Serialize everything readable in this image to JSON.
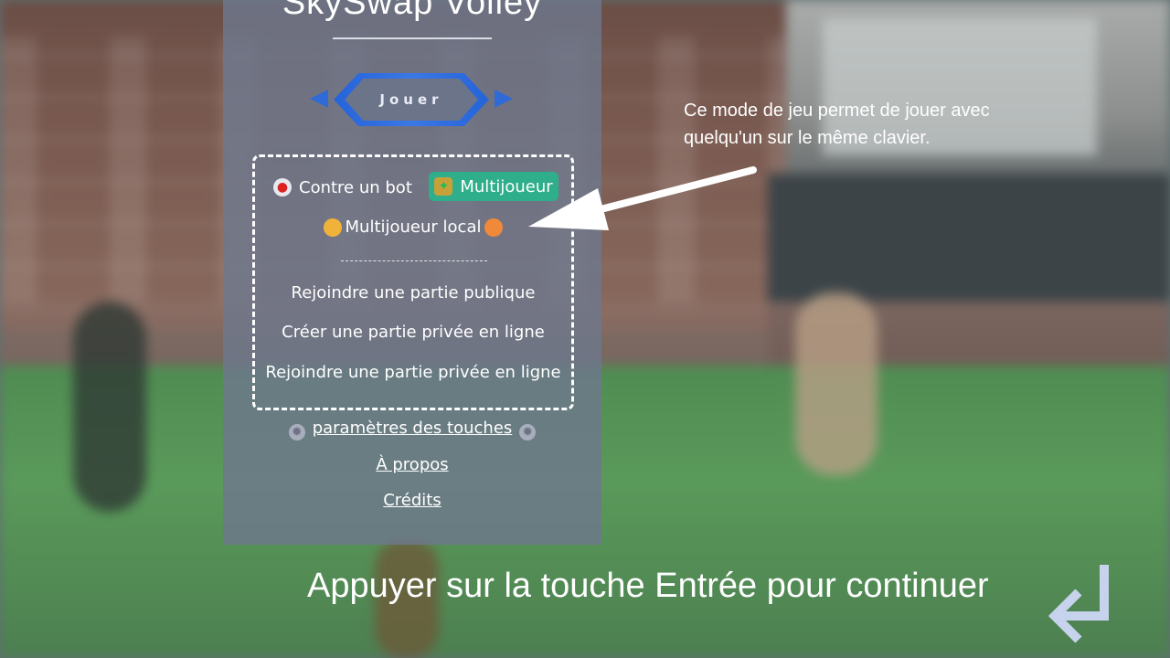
{
  "game": {
    "title": "SkySwap Volley",
    "play_label": "Jouer"
  },
  "modes": {
    "bot_label": "Contre un bot",
    "multiplayer_label": "Multijoueur",
    "local_label": "Multijoueur local",
    "separator": "-------------------------------",
    "online_options": [
      "Rejoindre une partie publique",
      "Créer une partie privée en ligne",
      "Rejoindre une partie privée en ligne"
    ]
  },
  "links": {
    "settings": "paramètres des touches",
    "about": "À propos",
    "credits": "Crédits"
  },
  "tutorial": {
    "tip": "Ce mode de jeu permet de jouer avec quelqu'un sur le même clavier.",
    "continue_prompt": "Appuyer sur la touche Entrée pour continuer"
  },
  "colors": {
    "accent_blue": "#2563d9",
    "multiplayer_green": "#2eae8a",
    "panel": "#6e788c"
  },
  "icons": [
    "robot-icon",
    "players-icon",
    "face-icon",
    "gear-icon",
    "enter-key-icon"
  ]
}
